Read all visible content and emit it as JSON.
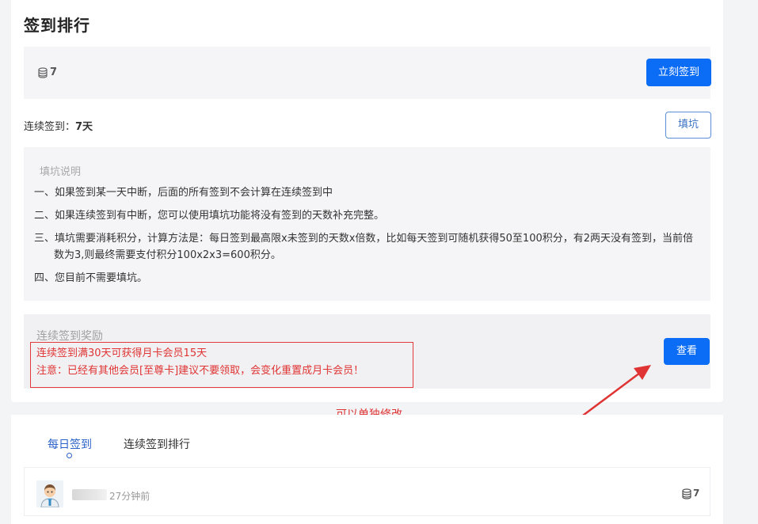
{
  "page": {
    "title": "签到排行"
  },
  "signin": {
    "points": "7",
    "button_label": "立刻签到",
    "coin_icon": "coin-stack-icon"
  },
  "streak": {
    "label": "连续签到：",
    "days": "7天",
    "fill_button_label": "填坑"
  },
  "explanation": {
    "title": "填坑说明",
    "rules": [
      "一、如果签到某一天中断，后面的所有签到不会计算在连续签到中",
      "二、如果连续签到有中断，您可以使用填坑功能将没有签到的天数补充完整。",
      "三、填坑需要消耗积分，计算方法是：每日签到最高限x未签到的天数x倍数，比如每天签到可随机获得50至100积分，有2两天没有签到，当前倍",
      "数为3,则最终需要支付积分100x2x3=600积分。",
      "四、您目前不需要填坑。"
    ]
  },
  "reward": {
    "title": "连续签到奖励",
    "line1": "连续签到满30天可获得月卡会员15天",
    "line2": "注意：已经有其他会员[至尊卡]建议不要领取，会变化重置成月卡会员！",
    "view_button_label": "查看"
  },
  "annotation": {
    "text": "可以单独修改"
  },
  "tabs": [
    {
      "label": "每日签到",
      "active": true
    },
    {
      "label": "连续签到排行",
      "active": false
    }
  ],
  "list": {
    "rows": [
      {
        "time": "27分钟前",
        "points": "7"
      }
    ]
  },
  "colors": {
    "accent": "#0b6cf5",
    "annotation_red": "#e03434"
  }
}
